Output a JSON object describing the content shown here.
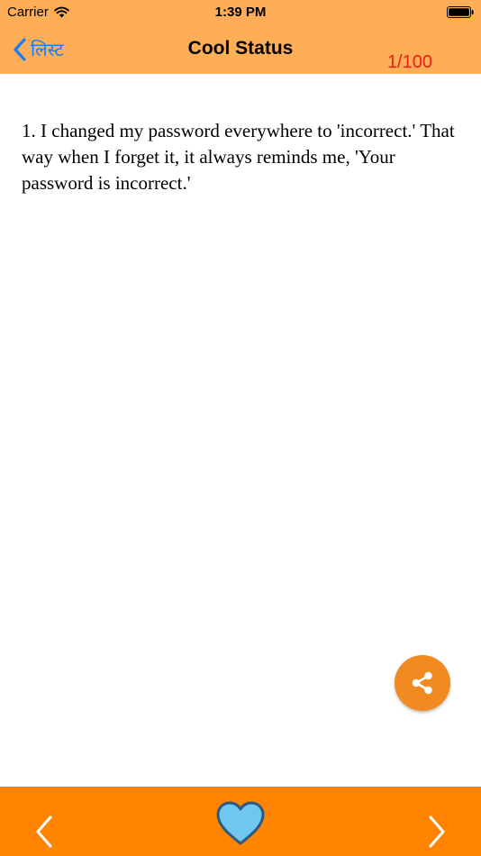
{
  "status_bar": {
    "carrier": "Carrier",
    "time": "1:39 PM",
    "wifi_icon": "wifi-icon",
    "battery_icon": "battery-icon"
  },
  "nav": {
    "back_label": "लिस्ट",
    "back_icon": "chevron-left-icon",
    "title": "Cool Status",
    "counter": "1/100"
  },
  "content": {
    "status_text": "1. I changed my password everywhere to 'incorrect.' That way when I forget it, it always reminds me, 'Your password is incorrect.'"
  },
  "actions": {
    "share_icon": "share-icon"
  },
  "bottom_bar": {
    "prev_icon": "chevron-left-icon",
    "favorite_icon": "heart-icon",
    "next_icon": "chevron-right-icon"
  },
  "colors": {
    "nav_background": "#FDAE57",
    "bottom_background": "#FF8400",
    "share_button": "#F28A22",
    "accent_blue": "#1A7CF2",
    "counter_red": "#E8201A",
    "heart_fill": "#6EC6F1"
  }
}
